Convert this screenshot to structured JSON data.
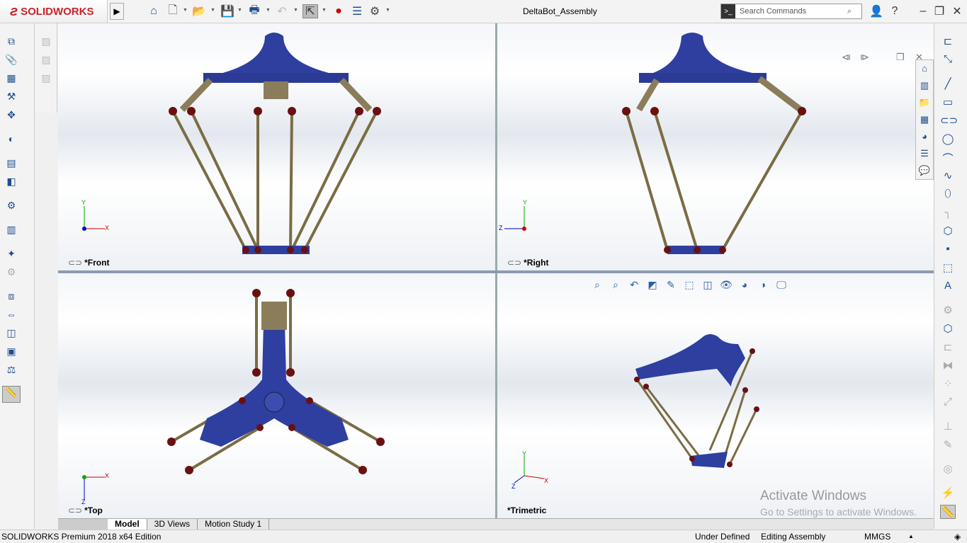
{
  "app": {
    "brand": "SOLIDWORKS",
    "title": "DeltaBot_Assembly"
  },
  "search": {
    "placeholder": "Search Commands"
  },
  "toolbar": {
    "icons": [
      "home-icon",
      "new-document-icon",
      "open-icon",
      "save-icon",
      "print-icon",
      "undo-icon",
      "select-icon",
      "rebuild-icon",
      "file-properties-icon",
      "options-icon"
    ]
  },
  "viewports": [
    {
      "label": "*Front"
    },
    {
      "label": "*Right"
    },
    {
      "label": "*Top"
    },
    {
      "label": "*Trimetric"
    }
  ],
  "axes": {
    "x": "X",
    "y": "Y",
    "z": "Z"
  },
  "tabs": [
    {
      "label": "Model",
      "active": true
    },
    {
      "label": "3D Views"
    },
    {
      "label": "Motion Study 1"
    }
  ],
  "status": {
    "edition": "SOLIDWORKS Premium 2018 x64 Edition",
    "state": "Under Defined",
    "mode": "Editing Assembly",
    "units": "MMGS"
  },
  "watermark": {
    "line1": "Activate Windows",
    "line2": "Go to Settings to activate Windows."
  },
  "colors": {
    "part_blue": "#2e3fa0",
    "arm": "#8b7d5a",
    "joint": "#6a1010",
    "accent": "#c8242b"
  }
}
